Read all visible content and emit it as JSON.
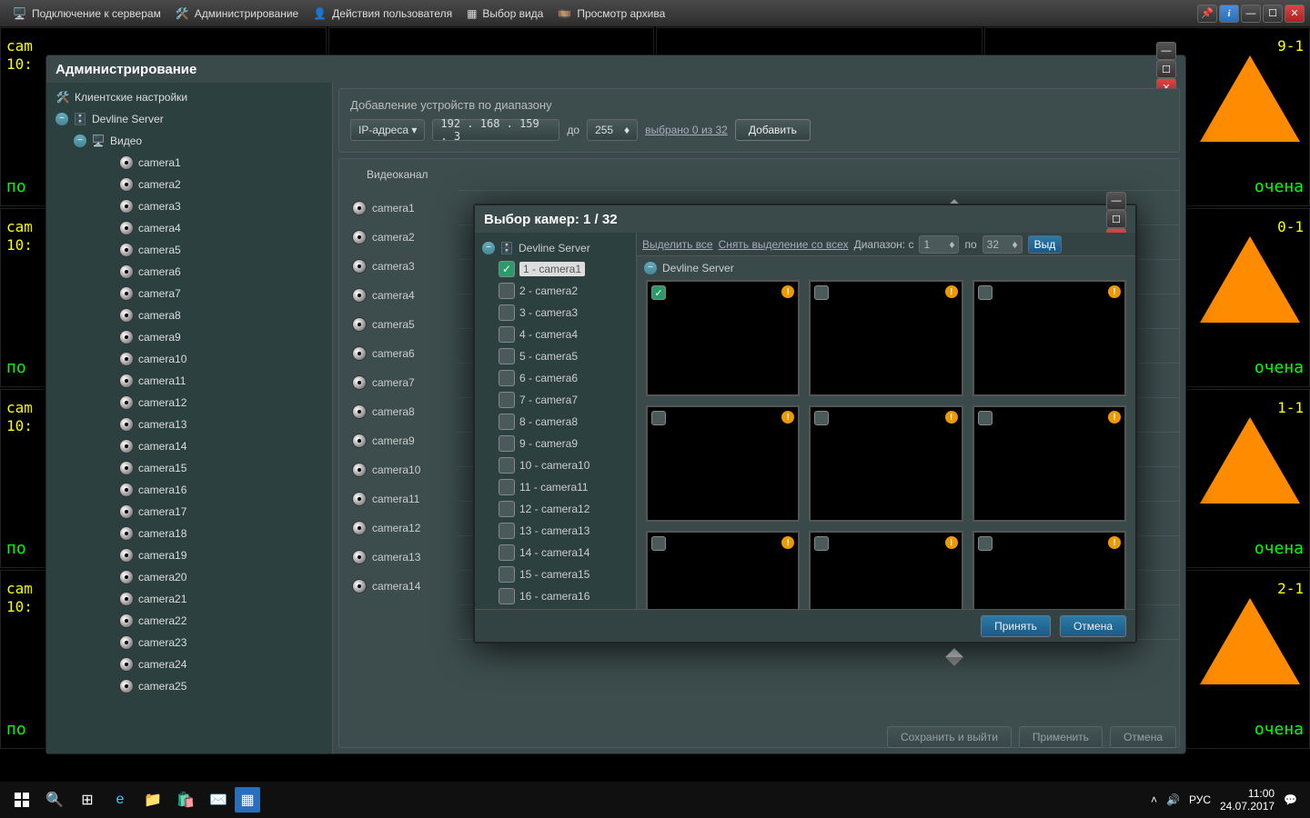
{
  "toolbar": {
    "connect": "Подключение к серверам",
    "admin": "Администрирование",
    "user_actions": "Действия пользователя",
    "view_select": "Выбор вида",
    "archive": "Просмотр архива"
  },
  "bg_cells": {
    "label1": "cam",
    "label2": "10:",
    "label3": "по",
    "right_suffixes": [
      "9-1",
      "0-1",
      "1-1",
      "2-1"
    ],
    "right_text": "очена"
  },
  "admin_window": {
    "title": "Администрирование",
    "tree": {
      "client_settings": "Клиентские настройки",
      "server": "Devline Server",
      "video": "Видео",
      "cameras": [
        "camera1",
        "camera2",
        "camera3",
        "camera4",
        "camera5",
        "camera6",
        "camera7",
        "camera8",
        "camera9",
        "camera10",
        "camera11",
        "camera12",
        "camera13",
        "camera14",
        "camera15",
        "camera16",
        "camera17",
        "camera18",
        "camera19",
        "camera20",
        "camera21",
        "camera22",
        "camera23",
        "camera24",
        "camera25"
      ]
    },
    "range_box": {
      "legend": "Добавление устройств по диапазону",
      "addr_type": "IP-адреса",
      "ip": "192 . 168 . 159 .   3",
      "to": "до",
      "to_val": "255",
      "selected": "выбрано 0 из 32",
      "add": "Добавить"
    },
    "channels": {
      "header": "Видеоканал",
      "list": [
        "camera1",
        "camera2",
        "camera3",
        "camera4",
        "camera5",
        "camera6",
        "camera7",
        "camera8",
        "camera9",
        "camera10",
        "camera11",
        "camera12",
        "camera13",
        "camera14"
      ]
    },
    "footer": {
      "save_exit": "Сохранить и выйти",
      "apply": "Применить",
      "cancel": "Отмена"
    }
  },
  "sel_dialog": {
    "title": "Выбор камер: 1 / 32",
    "server": "Devline Server",
    "items": [
      "1 - camera1",
      "2 - camera2",
      "3 - camera3",
      "4 - camera4",
      "5 - camera5",
      "6 - camera6",
      "7 - camera7",
      "8 - camera8",
      "9 - camera9",
      "10 - camera10",
      "11 - camera11",
      "12 - camera12",
      "13 - camera13",
      "14 - camera14",
      "15 - camera15",
      "16 - camera16"
    ],
    "toolbar": {
      "select_all": "Выделить все",
      "deselect_all": "Снять выделение со всех",
      "range_lbl": "Диапазон: с",
      "from": "1",
      "to_lbl": "по",
      "to": "32",
      "go": "Выд"
    },
    "server_header": "Devline Server",
    "footer": {
      "ok": "Принять",
      "cancel": "Отмена"
    }
  },
  "taskbar": {
    "lang": "РУС",
    "time": "11:00",
    "date": "24.07.2017"
  }
}
